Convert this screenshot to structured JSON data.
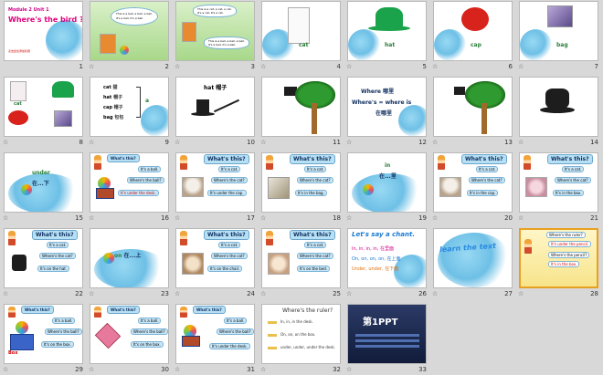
{
  "slides": [
    {
      "num": "1",
      "title": "Module 2 Unit 1",
      "subtitle": "Where's the bird ?",
      "footnote": "点击此处添加标题"
    },
    {
      "num": "2",
      "lines": [
        "This is a ball, a ball, a ball.",
        "It's a ball, it's a ball."
      ]
    },
    {
      "num": "3",
      "lines": [
        "This is a cat, a cat, a cat.",
        "It's a cat, It's a cat.",
        "This is a ball, a ball, a ball.",
        "It's a ball, it's a ball."
      ]
    },
    {
      "num": "4",
      "word": "cat"
    },
    {
      "num": "5",
      "word": "hat"
    },
    {
      "num": "6",
      "word": "cap"
    },
    {
      "num": "7",
      "word": "bag"
    },
    {
      "num": "8",
      "word": "cat"
    },
    {
      "num": "9",
      "rows": [
        {
          "en": "cat",
          "zh": "猫"
        },
        {
          "en": "hat",
          "zh": "帽子"
        },
        {
          "en": "cap",
          "zh": "帽子"
        },
        {
          "en": "bag",
          "zh": "包包"
        }
      ],
      "side": "a"
    },
    {
      "num": "10",
      "word": "hat",
      "zh": "帽子"
    },
    {
      "num": "11"
    },
    {
      "num": "12",
      "line1": "Where",
      "line1_zh": "哪里",
      "line2": "Where's = where is",
      "line3": "在哪里"
    },
    {
      "num": "13"
    },
    {
      "num": "14"
    },
    {
      "num": "15",
      "word": "under",
      "zh": "在...下"
    },
    {
      "num": "16",
      "q": "What's this?",
      "a": "It's a ball.",
      "q2": "Where's the ball?",
      "a2": "It's under the desk."
    },
    {
      "num": "17",
      "q": "What's this?",
      "a": "It's a cat.",
      "q2": "Where's the cat?",
      "a2": "It's under the cap."
    },
    {
      "num": "18",
      "q": "What's this?",
      "a": "It's a cat.",
      "q2": "Where's the cat?",
      "a2": "It's in the bag."
    },
    {
      "num": "19",
      "word": "in",
      "zh": "在...里"
    },
    {
      "num": "20",
      "q": "What's this?",
      "a": "It's a cat.",
      "q2": "Where's the cat?",
      "a2": "It's in the cap."
    },
    {
      "num": "21",
      "q": "What's this?",
      "a": "It's a cat.",
      "q2": "Where's the cat?",
      "a2": "It's in the box."
    },
    {
      "num": "22",
      "q": "What's this?",
      "a": "It's a cat.",
      "q2": "Where's the cat?",
      "a2": "It's on the hat."
    },
    {
      "num": "23",
      "word": "on",
      "zh": "在...上"
    },
    {
      "num": "24",
      "q": "What's this?",
      "a": "It's a cat.",
      "q2": "Where's the cat?",
      "a2": "It's on the chair."
    },
    {
      "num": "25",
      "q": "What's this?",
      "a": "It's a cat.",
      "q2": "Where's the cat?",
      "a2": "It's on the bed."
    },
    {
      "num": "26",
      "title": "Let's say a chant.",
      "l1": "In, in, in, in, 在里面",
      "l2": "On, on, on, on, 在上面",
      "l3": "Under, under, 在下面"
    },
    {
      "num": "27",
      "word": "learn the text"
    },
    {
      "num": "28",
      "l1": "Where's the ruler?",
      "l2": "It's under the pencil.",
      "l3": "Where's the pencil?",
      "l4": "It's in the box."
    },
    {
      "num": "29",
      "q": "What's this?",
      "a": "It's a ball.",
      "q2": "Where's the ball?",
      "a2": "It's on the box.",
      "label": "Box"
    },
    {
      "num": "30",
      "q": "What's this?",
      "a": "It's a ball.",
      "q2": "Where's the ball?",
      "a2": "It's on the box."
    },
    {
      "num": "31",
      "q": "What's this?",
      "a": "It's a ball.",
      "q2": "Where's the ball?",
      "a2": "It's under the desk."
    },
    {
      "num": "32",
      "title": "Where's the ruler?",
      "l1": "In, in, in the desk.",
      "l2": "On, on, on the box.",
      "l3": "under, under, under the desk."
    },
    {
      "num": "33",
      "brand": "第1PPT"
    }
  ],
  "star_glyph": "☆",
  "colors": {
    "bg": "#d8d8d8",
    "selected_border": "#e8a020",
    "red": "#d00000",
    "navy": "#103060"
  }
}
